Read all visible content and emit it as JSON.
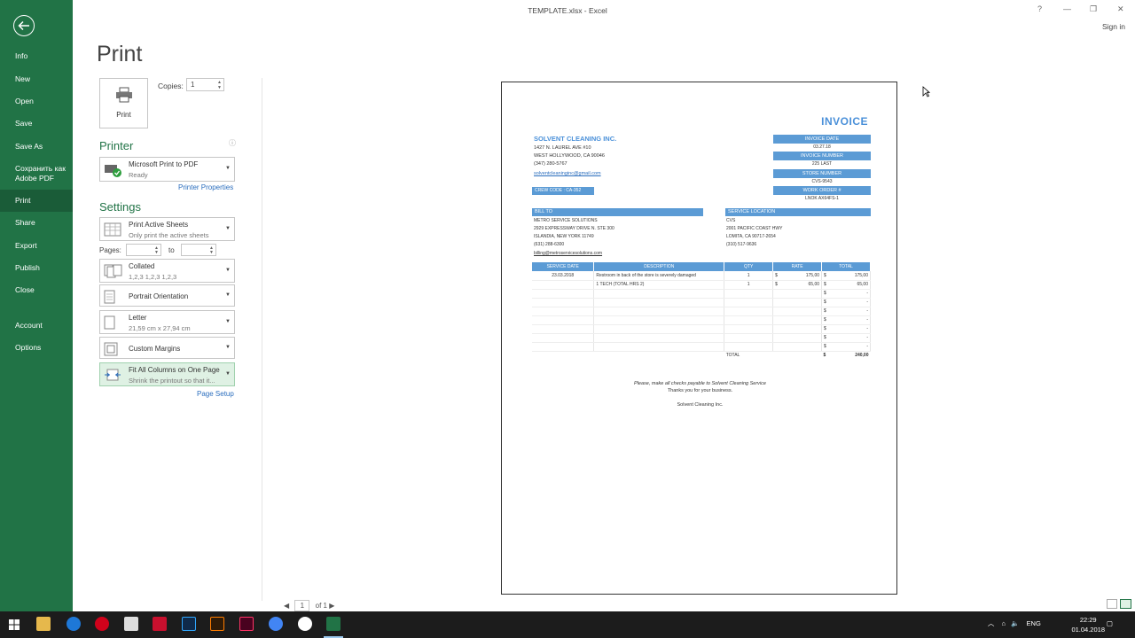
{
  "window": {
    "title": "TEMPLATE.xlsx - Excel",
    "help": "?",
    "minimize": "—",
    "restore": "❐",
    "close": "✕",
    "signin": "Sign in"
  },
  "nav": {
    "items": [
      "Info",
      "New",
      "Open",
      "Save",
      "Save As",
      "Сохранить как",
      "Adobe PDF",
      "Print",
      "Share",
      "Export",
      "Publish",
      "Close",
      "Account",
      "Options"
    ]
  },
  "print": {
    "heading": "Print",
    "button": "Print",
    "copies_label": "Copies:",
    "copies_value": "1",
    "printer_section": "Printer",
    "printer_name": "Microsoft Print to PDF",
    "printer_status": "Ready",
    "printer_properties": "Printer Properties",
    "settings_section": "Settings",
    "active_sheets": "Print Active Sheets",
    "active_sheets_desc": "Only print the active sheets",
    "pages_label": "Pages:",
    "to_label": "to",
    "collated": "Collated",
    "collated_desc": "1,2,3    1,2,3    1,2,3",
    "orientation": "Portrait Orientation",
    "paper": "Letter",
    "paper_desc": "21,59 cm x 27,94 cm",
    "margins": "Custom Margins",
    "scaling": "Fit All Columns on One Page",
    "scaling_desc": "Shrink the printout so that it...",
    "page_setup": "Page Setup",
    "pager_page": "1",
    "pager_of": "of 1"
  },
  "invoice": {
    "title": "INVOICE",
    "company": "SOLVENT CLEANING INC.",
    "addr1": "1427 N. LAUREL AVE #10",
    "addr2": "WEST HOLLYWOOD, CA 90046",
    "phone": "(347) 280-5767",
    "email": "solventcleaninginc@gmail.com",
    "invoice_date_label": "INVOICE DATE",
    "invoice_date": "03.27.18",
    "invoice_number_label": "INVOICE NUMBER",
    "invoice_number": "225 LAST",
    "store_number_label": "STORE NUMBER",
    "store_number": "CVS-9543",
    "work_order_label": "WORK ORDER #",
    "work_order": "LNOK AX64FS-1",
    "crew_code": "CREW CODE : CA-352",
    "bill_to_label": "BILL TO",
    "bill_name": "METRO SERVICE SOLUTIONS",
    "bill_addr1": "2929 EXPRESSWAY DRIVE N. STE 300",
    "bill_addr2": "ISLANDIA, NEW YORK 11749",
    "bill_phone": "(631) 288-6300",
    "bill_email": "billing@metroservicesolutions.com",
    "service_loc_label": "SERVICE LOCATION",
    "svc_name": "CVS",
    "svc_addr1": "2001 PACIFIC COAST HWY",
    "svc_addr2": "LOMITA, CA 90717-2654",
    "svc_phone": "(310) 517-9636",
    "headers": [
      "SERVICE DATE",
      "DESCRIPTION",
      "QTY",
      "RATE",
      "TOTAL"
    ],
    "rows": [
      {
        "date": "23.03.2018",
        "desc": "Restroom in back of the store is severely damaged",
        "qty": "1",
        "rate_sym": "$",
        "rate": "175,00",
        "total_sym": "$",
        "total": "175,00"
      },
      {
        "date": "",
        "desc": "1 TECH (TOTAL HRS 2)",
        "qty": "1",
        "rate_sym": "$",
        "rate": "65,00",
        "total_sym": "$",
        "total": "65,00"
      },
      {
        "date": "",
        "desc": "",
        "qty": "",
        "rate_sym": "",
        "rate": "",
        "total_sym": "$",
        "total": "-"
      },
      {
        "date": "",
        "desc": "",
        "qty": "",
        "rate_sym": "",
        "rate": "",
        "total_sym": "$",
        "total": "-"
      },
      {
        "date": "",
        "desc": "",
        "qty": "",
        "rate_sym": "",
        "rate": "",
        "total_sym": "$",
        "total": "-"
      },
      {
        "date": "",
        "desc": "",
        "qty": "",
        "rate_sym": "",
        "rate": "",
        "total_sym": "$",
        "total": "-"
      },
      {
        "date": "",
        "desc": "",
        "qty": "",
        "rate_sym": "",
        "rate": "",
        "total_sym": "$",
        "total": "-"
      },
      {
        "date": "",
        "desc": "",
        "qty": "",
        "rate_sym": "",
        "rate": "",
        "total_sym": "$",
        "total": "-"
      },
      {
        "date": "",
        "desc": "",
        "qty": "",
        "rate_sym": "",
        "rate": "",
        "total_sym": "$",
        "total": "-"
      }
    ],
    "total_label": "TOTAL",
    "total_sym": "$",
    "total_value": "240,00",
    "note1": "Please, make all checks payable to Solvent Cleaning Service",
    "note2": "Thanks you for your business.",
    "note3": "Solvent Cleaning Inc."
  },
  "taskbar": {
    "lang": "ENG",
    "time": "22:29",
    "date": "01.04.2018"
  }
}
